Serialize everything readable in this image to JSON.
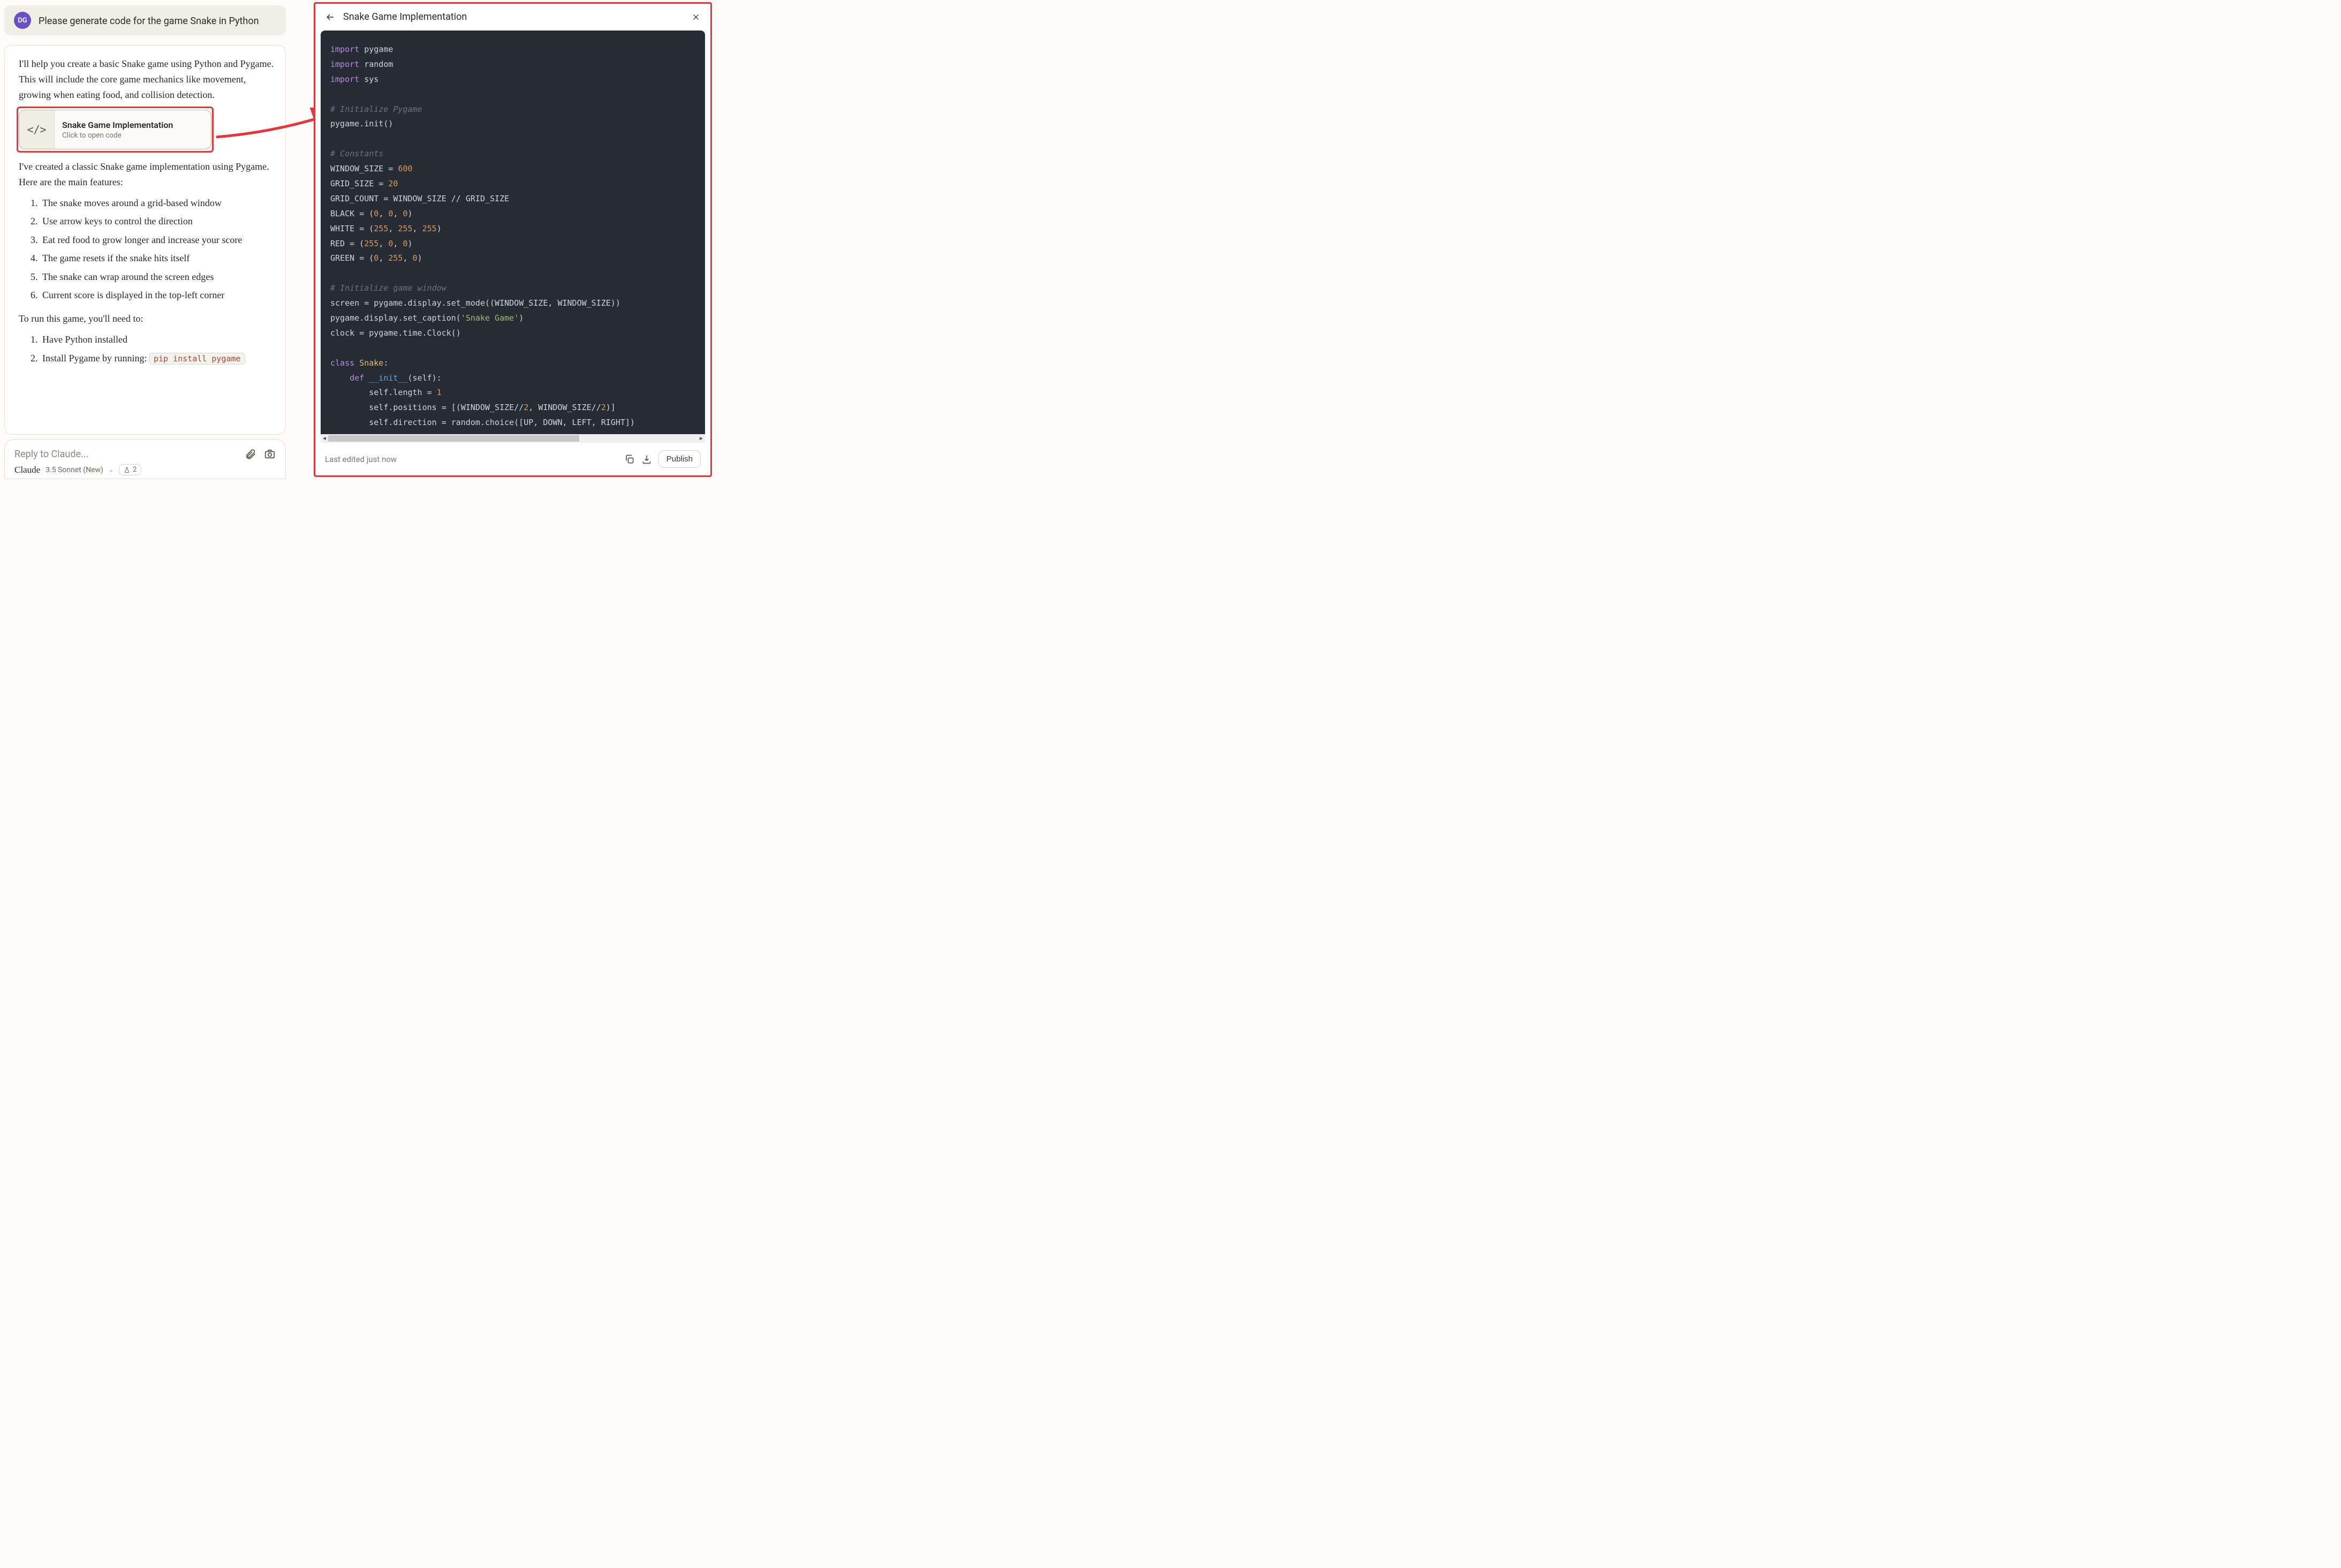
{
  "user": {
    "avatar_initials": "DG",
    "message": "Please generate code for the game Snake in Python"
  },
  "assistant": {
    "intro": "I'll help you create a basic Snake game using Python and Pygame. This will include the core game mechanics like movement, growing when eating food, and collision detection.",
    "artifact_card": {
      "icon_glyph": "</>",
      "title": "Snake Game Implementation",
      "subtitle": "Click to open code"
    },
    "after_card": "I've created a classic Snake game implementation using Pygame. Here are the main features:",
    "features": [
      "The snake moves around a grid-based window",
      "Use arrow keys to control the direction",
      "Eat red food to grow longer and increase your score",
      "The game resets if the snake hits itself",
      "The snake can wrap around the screen edges",
      "Current score is displayed in the top-left corner"
    ],
    "run_intro": "To run this game, you'll need to:",
    "run_steps": [
      "Have Python installed",
      "Install Pygame by running:"
    ],
    "run_code": "pip install pygame"
  },
  "input": {
    "placeholder": "Reply to Claude...",
    "brand": "Claude",
    "model": "3.5 Sonnet (New)",
    "chip_count": "2"
  },
  "artifact_panel": {
    "title": "Snake Game Implementation",
    "footer_status": "Last edited just now",
    "publish_label": "Publish"
  },
  "code_lines": [
    [
      [
        "kw",
        "import"
      ],
      [
        "sp",
        " "
      ],
      [
        "mod",
        "pygame"
      ]
    ],
    [
      [
        "kw",
        "import"
      ],
      [
        "sp",
        " "
      ],
      [
        "mod",
        "random"
      ]
    ],
    [
      [
        "kw",
        "import"
      ],
      [
        "sp",
        " "
      ],
      [
        "mod",
        "sys"
      ]
    ],
    [],
    [
      [
        "cm",
        "# Initialize Pygame"
      ]
    ],
    [
      [
        "id",
        "pygame.init()"
      ]
    ],
    [],
    [
      [
        "cm",
        "# Constants"
      ]
    ],
    [
      [
        "id",
        "WINDOW_SIZE "
      ],
      [
        "op",
        "= "
      ],
      [
        "num",
        "600"
      ]
    ],
    [
      [
        "id",
        "GRID_SIZE "
      ],
      [
        "op",
        "= "
      ],
      [
        "num",
        "20"
      ]
    ],
    [
      [
        "id",
        "GRID_COUNT "
      ],
      [
        "op",
        "= "
      ],
      [
        "id",
        "WINDOW_SIZE "
      ],
      [
        "op",
        "// "
      ],
      [
        "id",
        "GRID_SIZE"
      ]
    ],
    [
      [
        "id",
        "BLACK "
      ],
      [
        "op",
        "= ("
      ],
      [
        "num",
        "0"
      ],
      [
        "op",
        ", "
      ],
      [
        "num",
        "0"
      ],
      [
        "op",
        ", "
      ],
      [
        "num",
        "0"
      ],
      [
        "op",
        ")"
      ]
    ],
    [
      [
        "id",
        "WHITE "
      ],
      [
        "op",
        "= ("
      ],
      [
        "num",
        "255"
      ],
      [
        "op",
        ", "
      ],
      [
        "num",
        "255"
      ],
      [
        "op",
        ", "
      ],
      [
        "num",
        "255"
      ],
      [
        "op",
        ")"
      ]
    ],
    [
      [
        "id",
        "RED "
      ],
      [
        "op",
        "= ("
      ],
      [
        "num",
        "255"
      ],
      [
        "op",
        ", "
      ],
      [
        "num",
        "0"
      ],
      [
        "op",
        ", "
      ],
      [
        "num",
        "0"
      ],
      [
        "op",
        ")"
      ]
    ],
    [
      [
        "id",
        "GREEN "
      ],
      [
        "op",
        "= ("
      ],
      [
        "num",
        "0"
      ],
      [
        "op",
        ", "
      ],
      [
        "num",
        "255"
      ],
      [
        "op",
        ", "
      ],
      [
        "num",
        "0"
      ],
      [
        "op",
        ")"
      ]
    ],
    [],
    [
      [
        "cm",
        "# Initialize game window"
      ]
    ],
    [
      [
        "id",
        "screen "
      ],
      [
        "op",
        "= "
      ],
      [
        "id",
        "pygame.display.set_mode((WINDOW_SIZE, WINDOW_SIZE))"
      ]
    ],
    [
      [
        "id",
        "pygame.display.set_caption("
      ],
      [
        "str",
        "'Snake Game'"
      ],
      [
        "id",
        ")"
      ]
    ],
    [
      [
        "id",
        "clock "
      ],
      [
        "op",
        "= "
      ],
      [
        "id",
        "pygame.time.Clock()"
      ]
    ],
    [],
    [
      [
        "kw",
        "class "
      ],
      [
        "cls",
        "Snake"
      ],
      [
        "op",
        ":"
      ]
    ],
    [
      [
        "sp",
        "    "
      ],
      [
        "kw",
        "def "
      ],
      [
        "def",
        "__init__"
      ],
      [
        "id",
        "(self):"
      ]
    ],
    [
      [
        "sp",
        "        "
      ],
      [
        "id",
        "self.length "
      ],
      [
        "op",
        "= "
      ],
      [
        "num",
        "1"
      ]
    ],
    [
      [
        "sp",
        "        "
      ],
      [
        "id",
        "self.positions "
      ],
      [
        "op",
        "= "
      ],
      [
        "id",
        "[(WINDOW_SIZE"
      ],
      [
        "op",
        "//"
      ],
      [
        "num",
        "2"
      ],
      [
        "id",
        ", WINDOW_SIZE"
      ],
      [
        "op",
        "//"
      ],
      [
        "num",
        "2"
      ],
      [
        "id",
        ")]"
      ]
    ],
    [
      [
        "sp",
        "        "
      ],
      [
        "id",
        "self.direction "
      ],
      [
        "op",
        "= "
      ],
      [
        "id",
        "random.choice([UP, DOWN, LEFT, RIGHT])"
      ]
    ]
  ]
}
